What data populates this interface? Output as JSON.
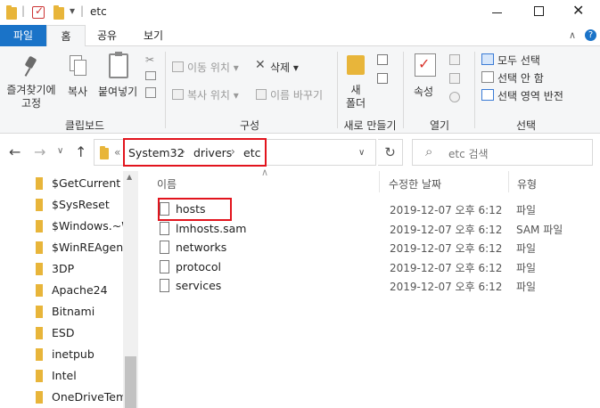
{
  "window": {
    "title": "etc",
    "min_icon": "minimize-icon",
    "max_icon": "maximize-icon",
    "close_icon": "close-icon"
  },
  "qat": {
    "sep": "|",
    "dropdown": "▾",
    "divider": "|"
  },
  "tabs": {
    "file": "파일",
    "home": "홈",
    "share": "공유",
    "view": "보기"
  },
  "ribbon": {
    "pin_label1": "즐겨찾기에",
    "pin_label2": "고정",
    "copy": "복사",
    "paste": "붙여넣기",
    "move_to": "이동 위치",
    "copy_to": "복사 위치",
    "delete": "삭제",
    "rename": "이름 바꾸기",
    "new_folder1": "새",
    "new_folder2": "폴더",
    "properties": "속성",
    "select_all": "모두 선택",
    "select_none": "선택 안 함",
    "invert_selection": "선택 영역 반전",
    "groups": {
      "clipboard": "클립보드",
      "organize": "구성",
      "new": "새로 만들기",
      "open": "열기",
      "select": "선택"
    }
  },
  "address": {
    "prefix": "«",
    "crumbs": [
      "System32",
      "drivers",
      "etc"
    ],
    "sep": "›",
    "search_placeholder": "etc 검색"
  },
  "sidebar": {
    "items": [
      "$GetCurrent",
      "$SysReset",
      "$Windows.~W",
      "$WinREAgent",
      "3DP",
      "Apache24",
      "Bitnami",
      "ESD",
      "inetpub",
      "Intel",
      "OneDriveTemp"
    ]
  },
  "filelist": {
    "columns": {
      "name": "이름",
      "modified": "수정한 날짜",
      "type": "유형"
    },
    "rows": [
      {
        "name": "hosts",
        "modified": "2019-12-07 오후 6:12",
        "type": "파일"
      },
      {
        "name": "lmhosts.sam",
        "modified": "2019-12-07 오후 6:12",
        "type": "SAM 파일"
      },
      {
        "name": "networks",
        "modified": "2019-12-07 오후 6:12",
        "type": "파일"
      },
      {
        "name": "protocol",
        "modified": "2019-12-07 오후 6:12",
        "type": "파일"
      },
      {
        "name": "services",
        "modified": "2019-12-07 오후 6:12",
        "type": "파일"
      }
    ]
  },
  "nav_icons": {
    "back": "←",
    "forward": "→",
    "recent": "∨",
    "up": "↑",
    "chevron": "∨",
    "refresh": "↻",
    "search": "⌕",
    "help": "?",
    "collapse": "∧",
    "sort": "∧"
  }
}
